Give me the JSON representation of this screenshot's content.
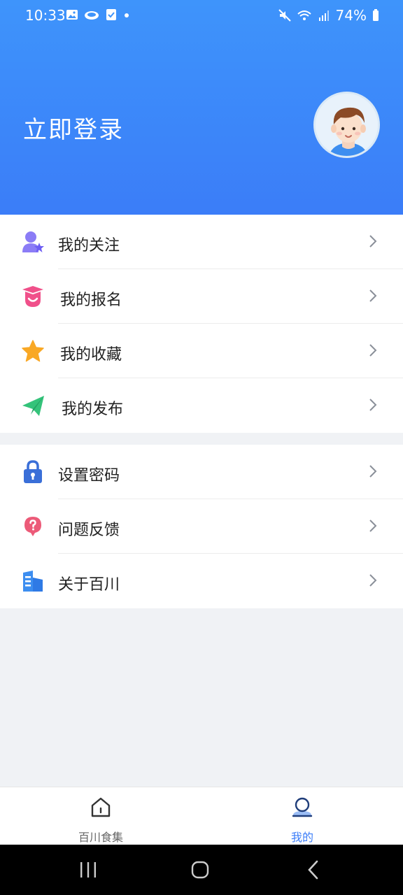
{
  "status_bar": {
    "time": "10:33",
    "battery": "74%"
  },
  "header": {
    "login_label": "立即登录"
  },
  "menu_group_1": [
    {
      "label": "我的关注",
      "icon": "user-star-icon"
    },
    {
      "label": "我的报名",
      "icon": "graduation-cap-icon"
    },
    {
      "label": "我的收藏",
      "icon": "star-icon"
    },
    {
      "label": "我的发布",
      "icon": "paper-plane-icon"
    }
  ],
  "menu_group_2": [
    {
      "label": "设置密码",
      "icon": "lock-icon"
    },
    {
      "label": "问题反馈",
      "icon": "question-bubble-icon"
    },
    {
      "label": "关于百川",
      "icon": "building-icon"
    }
  ],
  "tabbar": {
    "tabs": [
      {
        "label": "百川食集",
        "icon": "home-icon",
        "active": false
      },
      {
        "label": "我的",
        "icon": "profile-icon",
        "active": true
      }
    ]
  },
  "colors": {
    "header_top": "#3e94fb",
    "header_bottom": "#3b7df8",
    "active_tab": "#3b7df8",
    "inactive_tab": "#666666"
  }
}
